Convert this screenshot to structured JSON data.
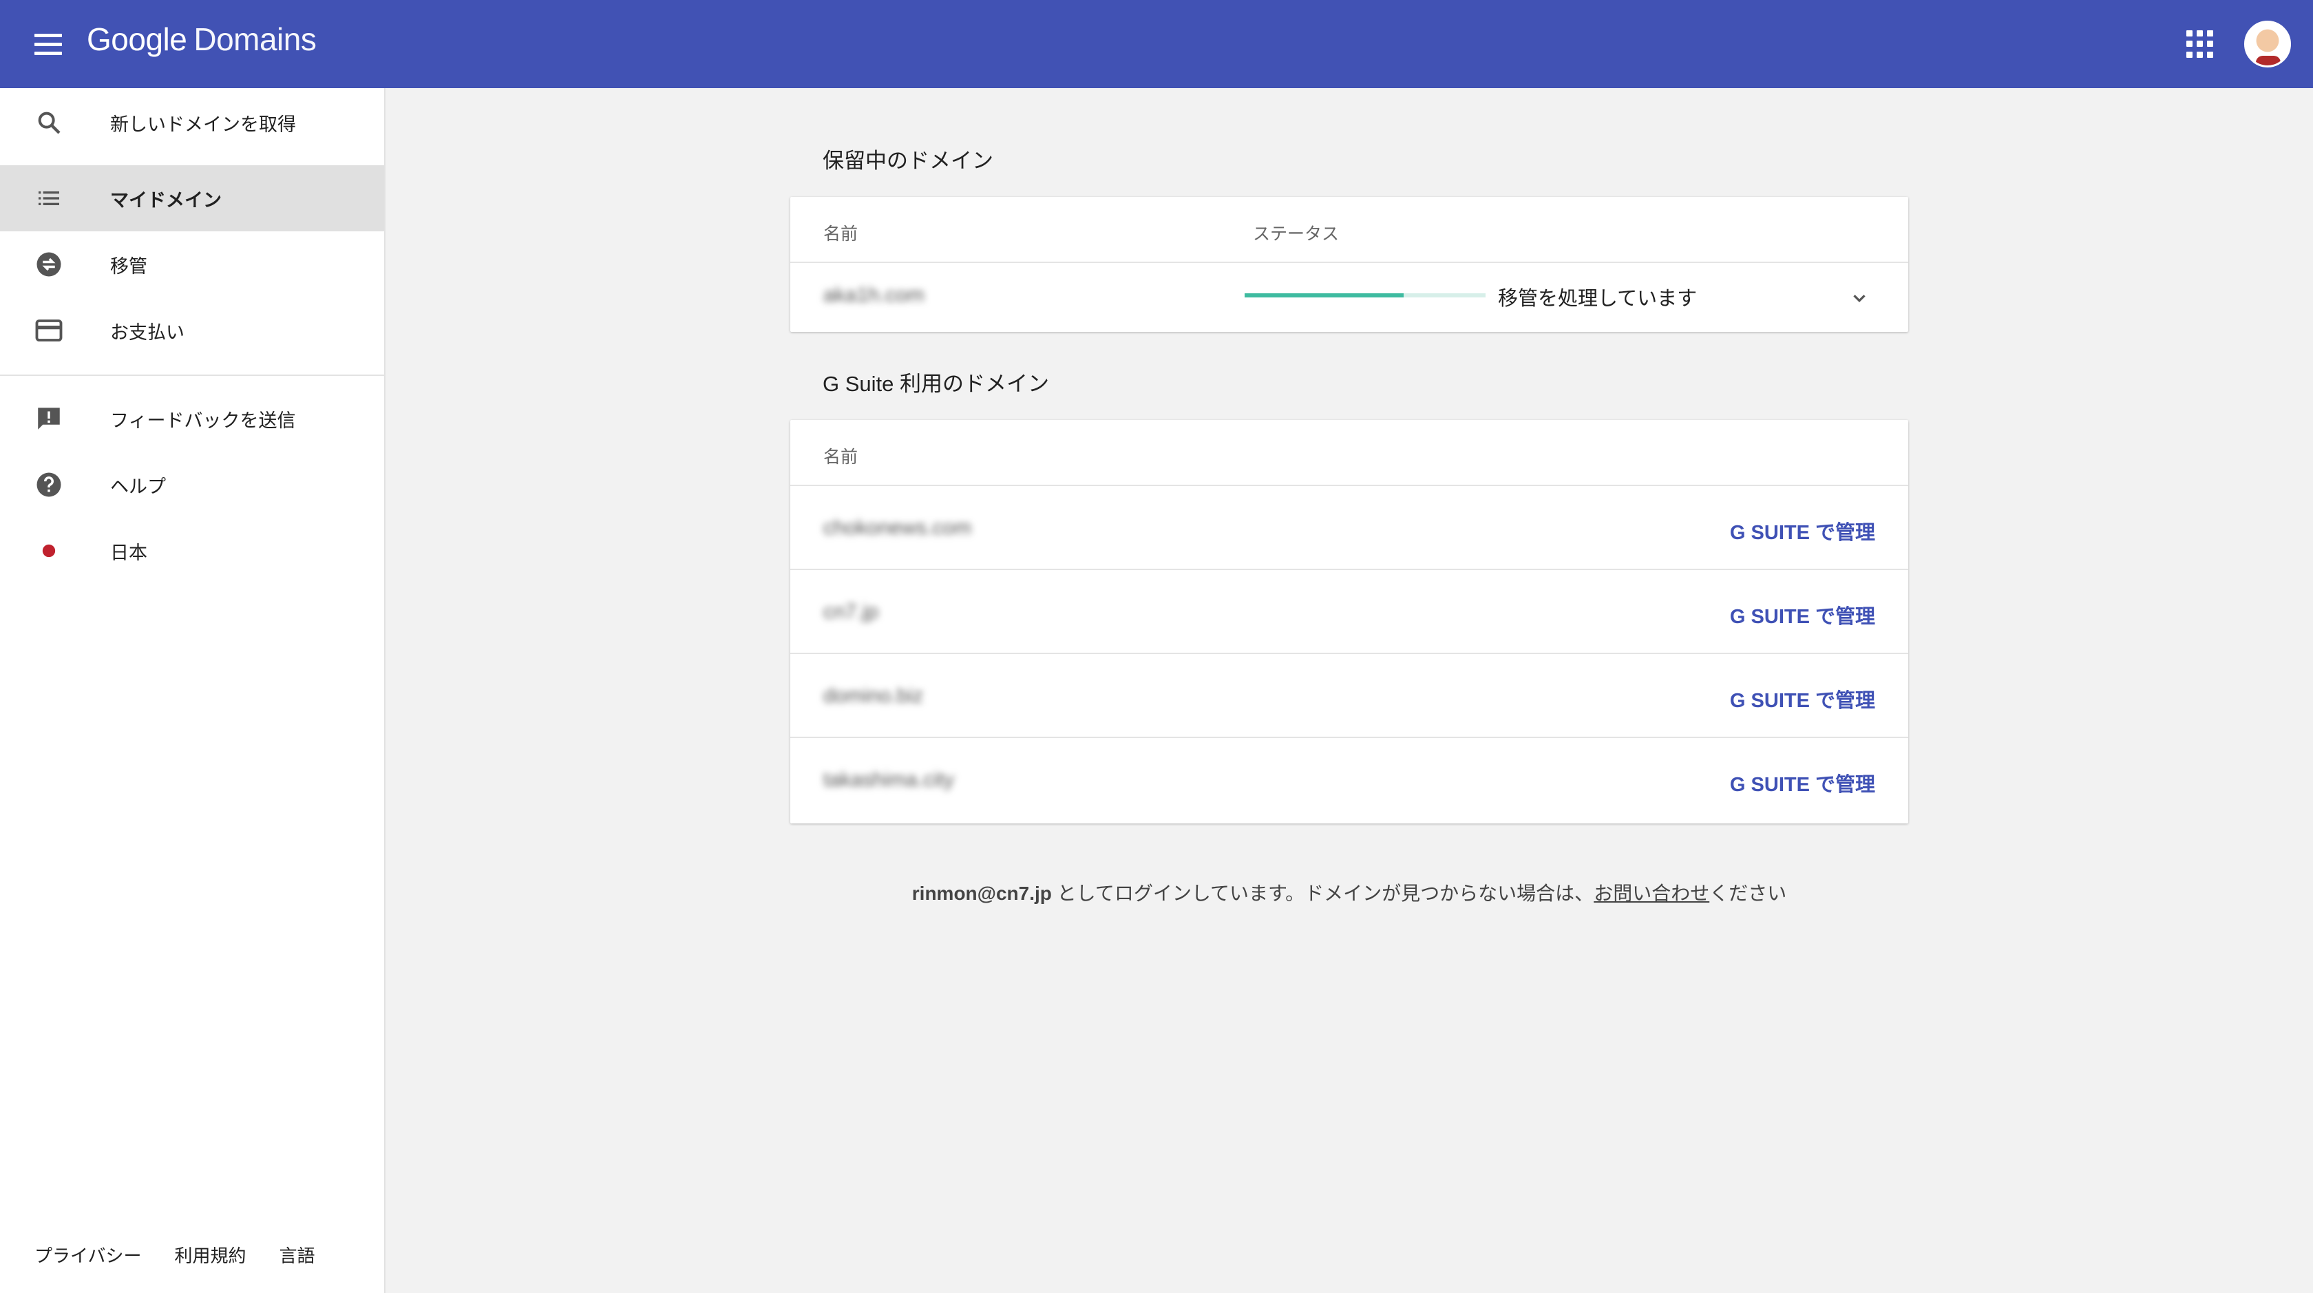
{
  "header": {
    "brand_google": "Google",
    "brand_domains": "Domains"
  },
  "sidebar": {
    "items": [
      {
        "label": "新しいドメインを取得",
        "icon": "search-icon"
      },
      {
        "label": "マイドメイン",
        "icon": "list-icon",
        "active": true
      },
      {
        "label": "移管",
        "icon": "transfer-icon"
      },
      {
        "label": "お支払い",
        "icon": "credit-card-icon"
      },
      {
        "label": "フィードバックを送信",
        "icon": "feedback-icon"
      },
      {
        "label": "ヘルプ",
        "icon": "help-icon"
      },
      {
        "label": "日本",
        "icon": "japan-flag-icon"
      }
    ],
    "footer": [
      "プライバシー",
      "利用規約",
      "言語"
    ]
  },
  "pending": {
    "title": "保留中のドメイン",
    "col_name": "名前",
    "col_status": "ステータス",
    "rows": [
      {
        "name": "aka1h.com",
        "status": "移管を処理しています",
        "progress": 0.66
      }
    ]
  },
  "gsuite": {
    "title": "G Suite 利用のドメイン",
    "col_name": "名前",
    "manage_label": "G SUITE で管理",
    "rows": [
      {
        "name": "chokonews.com"
      },
      {
        "name": "cn7.jp"
      },
      {
        "name": "domino.biz"
      },
      {
        "name": "takashima.city"
      }
    ]
  },
  "login_note": {
    "email": "rinmon@cn7.jp",
    "text_mid": " としてログインしています。ドメインが見つからない場合は、",
    "link": "お問い合わせ",
    "text_end": "ください"
  },
  "colors": {
    "appbar": "#4152b4",
    "accent": "#3f51b5",
    "progress": "#3ebba0",
    "flag": "#c0212e"
  }
}
